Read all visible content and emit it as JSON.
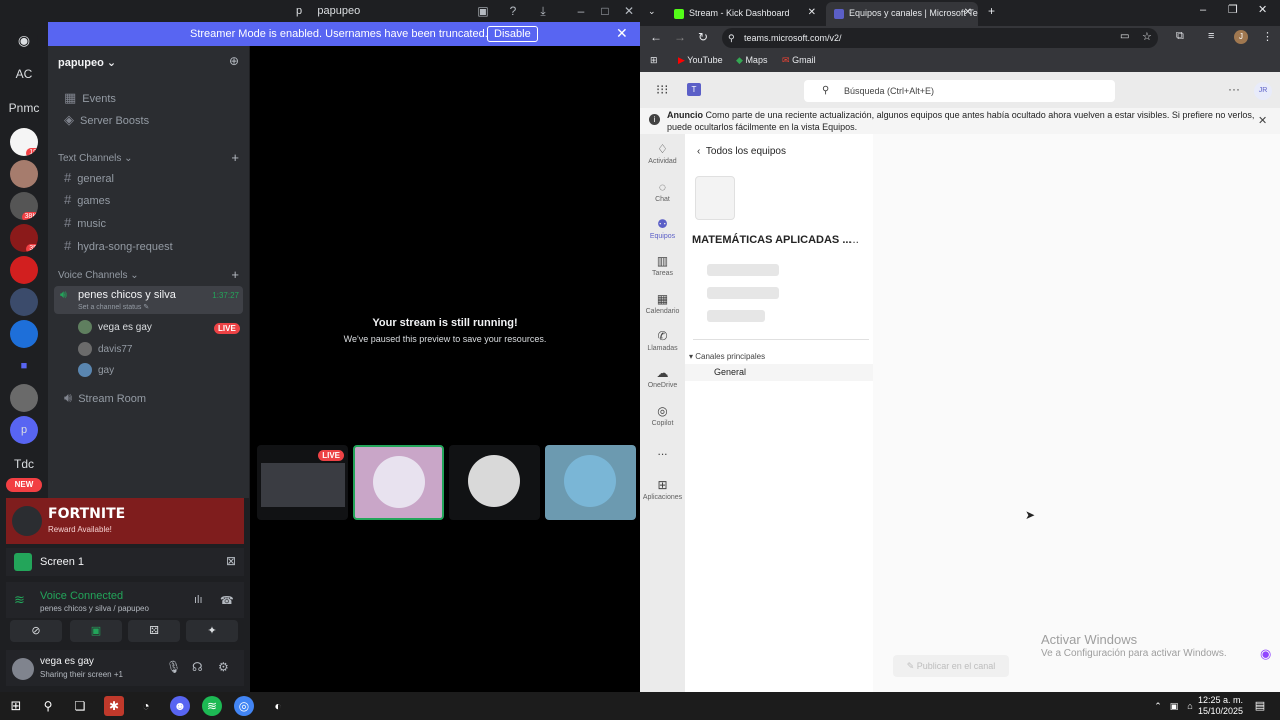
{
  "discord": {
    "window_title_letter": "p",
    "window_title": "papupeo",
    "banner": {
      "message": "Streamer Mode is enabled. Usernames have been truncated.",
      "disable_label": "Disable"
    },
    "server_name": "papupeo",
    "servers": [
      {
        "label": "AC"
      },
      {
        "label": "Pnmc"
      },
      {
        "label": "19",
        "badge": true
      },
      {
        "label": ""
      },
      {
        "label": "38K",
        "badge": true
      },
      {
        "label": "35",
        "badge": true
      },
      {
        "label": ""
      },
      {
        "label": ""
      },
      {
        "label": ""
      },
      {
        "label": "p"
      },
      {
        "label": "Tdc"
      },
      {
        "label": "NEW"
      }
    ],
    "menu": {
      "events": "Events",
      "boosts": "Server Boosts"
    },
    "text_channels_label": "Text Channels",
    "text_channels": [
      "general",
      "games",
      "music",
      "hydra-song-request"
    ],
    "voice_channels_label": "Voice Channels",
    "voice_channel": {
      "name": "penes chicos y silva",
      "time": "1:37:27",
      "status": "Set a channel status"
    },
    "voice_users": [
      {
        "name": "vega es gay",
        "live": "LIVE"
      },
      {
        "name": "davis77",
        "live": ""
      },
      {
        "name": "gay",
        "live": ""
      }
    ],
    "stream_room": "Stream Room",
    "fortnite": {
      "title": "FORTNITE",
      "subtitle": "Reward Available!"
    },
    "screen": {
      "label": "Screen 1"
    },
    "voice_connected": {
      "title": "Voice Connected",
      "subtitle": "penes chicos y silva / papupeo"
    },
    "me": {
      "name": "vega es gay",
      "status": "Sharing their screen +1"
    },
    "stream_message": {
      "title": "Your stream is still running!",
      "subtitle": "We've paused this preview to save your resources."
    },
    "tile_live": "LIVE"
  },
  "chrome": {
    "tabs": [
      {
        "title": "Stream - Kick Dashboard",
        "color": "#53fc18"
      },
      {
        "title": "Equipos y canales | Microsoft Te",
        "color": "#5b5fc7"
      }
    ],
    "url": "teams.microsoft.com/v2/",
    "bookmarks": [
      "YouTube",
      "Maps",
      "Gmail"
    ],
    "avatar": "J"
  },
  "teams": {
    "search_placeholder": "Búsqueda (Ctrl+Alt+E)",
    "avatar": "JR",
    "announcement": {
      "label": "Anuncio",
      "text": "Como parte de una reciente actualización, algunos equipos que antes había ocultado ahora vuelven a estar visibles. Si prefiere no verlos, puede ocultarlos fácilmente en la vista Equipos."
    },
    "rail": [
      {
        "label": "Actividad"
      },
      {
        "label": "Chat"
      },
      {
        "label": "Equipos",
        "active": true
      },
      {
        "label": "Tareas"
      },
      {
        "label": "Calendario"
      },
      {
        "label": "Llamadas"
      },
      {
        "label": "OneDrive"
      },
      {
        "label": "Copilot"
      },
      {
        "label": "..."
      },
      {
        "label": "Aplicaciones"
      }
    ],
    "back_label": "Todos los equipos",
    "team_name": "MATEMÁTICAS APLICADAS ...",
    "more": "...",
    "channels_header": "Canales principales",
    "channel": "General",
    "post_label": "Publicar en el canal",
    "watermark_title": "Activar Windows",
    "watermark_sub": "Ve a Configuración para activar Windows."
  },
  "taskbar": {
    "time": "12:25 a. m.",
    "date": "15/10/2025"
  }
}
